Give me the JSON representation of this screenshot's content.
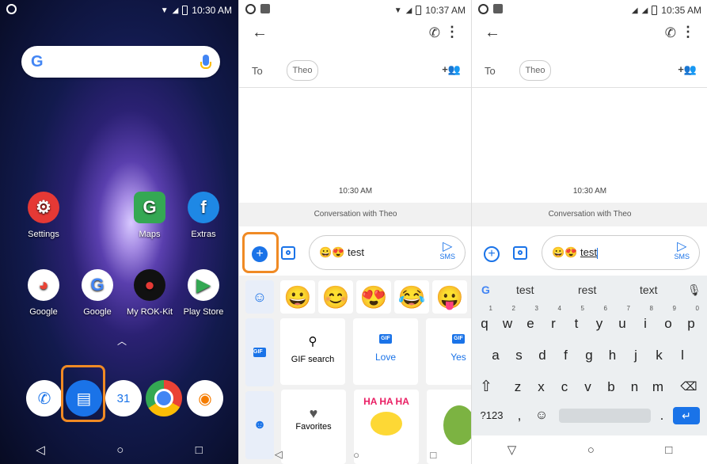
{
  "home": {
    "time": "10:30 AM",
    "apps": [
      {
        "label": "Settings",
        "icon": "settings-icon",
        "color": "#e53935",
        "glyph": "⚙"
      },
      {
        "label": "Maps",
        "icon": "maps-icon",
        "color": "#34a853",
        "glyph": "G"
      },
      {
        "label": "Extras",
        "icon": "extras-folder-icon",
        "color": "#1e88e5",
        "glyph": "f"
      },
      {
        "label": "Google",
        "icon": "google-folder-icon",
        "color": "#ffffff",
        "glyph": "◕"
      },
      {
        "label": "Google",
        "icon": "google-icon",
        "color": "#ffffff",
        "glyph": "G"
      },
      {
        "label": "My ROK-Kit",
        "icon": "rok-kit-icon",
        "color": "#111111",
        "glyph": "●"
      },
      {
        "label": "Play Store",
        "icon": "play-store-icon",
        "color": "#ffffff",
        "glyph": "▶"
      }
    ],
    "dock_calendar": "31"
  },
  "msg1": {
    "time": "10:37 AM",
    "to_label": "To",
    "recipient": "Theo",
    "timestamp": "10:30 AM",
    "conversation_label": "Conversation with Theo",
    "message_text": "😀😍 test",
    "send_label": "SMS",
    "emojis": [
      "😀",
      "😊",
      "😍",
      "😂",
      "😛"
    ],
    "gif_tab": "GIF",
    "gif_cards": [
      "GIF search",
      "Love",
      "Yes"
    ],
    "sticker_cards": [
      "Favorites"
    ]
  },
  "msg2": {
    "time": "10:35 AM",
    "to_label": "To",
    "recipient": "Theo",
    "timestamp": "10:30 AM",
    "conversation_label": "Conversation with Theo",
    "message_prefix": "😀😍",
    "message_word": "test",
    "send_label": "SMS",
    "suggestions": [
      "test",
      "rest",
      "text"
    ],
    "row1": [
      [
        "q",
        "1"
      ],
      [
        "w",
        "2"
      ],
      [
        "e",
        "3"
      ],
      [
        "r",
        "4"
      ],
      [
        "t",
        "5"
      ],
      [
        "y",
        "6"
      ],
      [
        "u",
        "7"
      ],
      [
        "i",
        "8"
      ],
      [
        "o",
        "9"
      ],
      [
        "p",
        "0"
      ]
    ],
    "row2": [
      "a",
      "s",
      "d",
      "f",
      "g",
      "h",
      "j",
      "k",
      "l"
    ],
    "row3": [
      "z",
      "x",
      "c",
      "v",
      "b",
      "n",
      "m"
    ],
    "sym_key": "?123",
    "comma": ",",
    "period": "."
  },
  "colors": {
    "accent": "#1a73e8",
    "highlight": "#f08a24"
  }
}
